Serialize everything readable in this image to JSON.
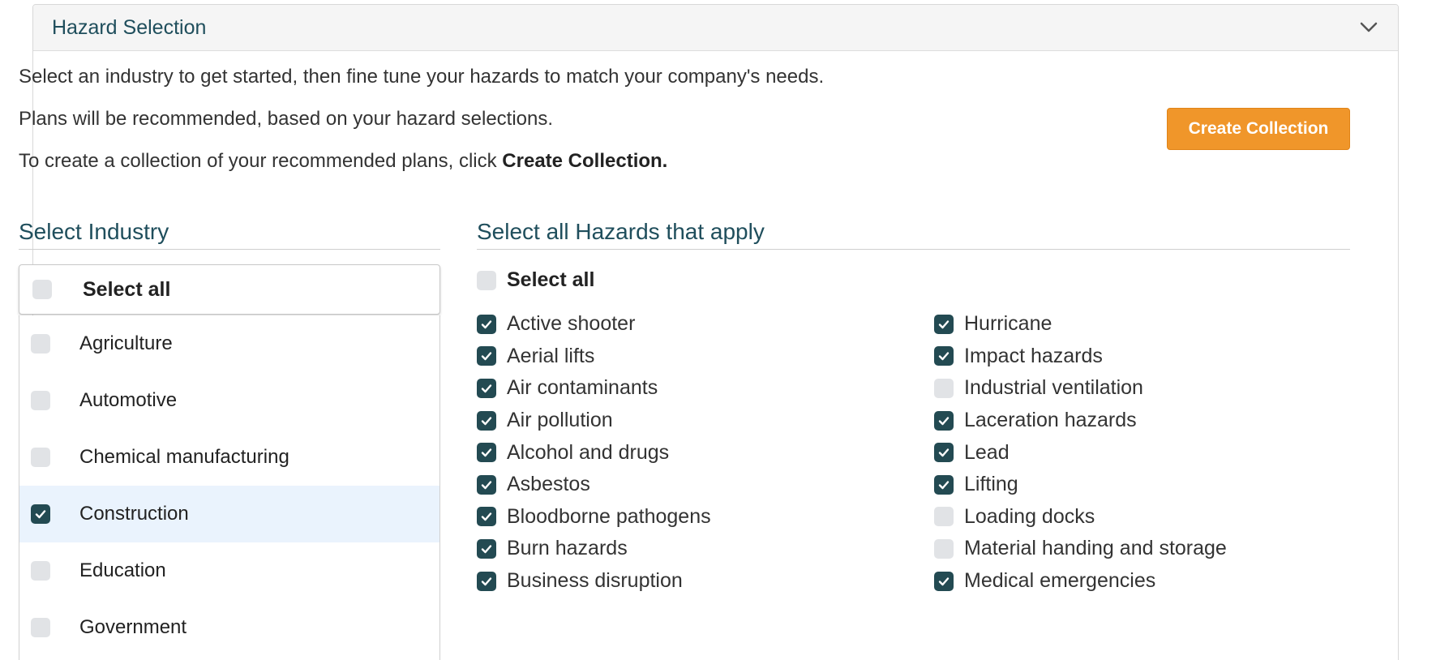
{
  "panel": {
    "title": "Hazard Selection",
    "collapse_icon": "chevron-down-icon"
  },
  "intro": {
    "line1": "Select an industry to get started, then fine tune your hazards to match your company's needs.",
    "line2": "Plans will be recommended, based on your hazard selections.",
    "line3_prefix": "To create a collection of your recommended plans, click ",
    "line3_bold": "Create Collection."
  },
  "create_button": "Create Collection",
  "industry": {
    "title": "Select Industry",
    "select_all": {
      "label": "Select all",
      "checked": false
    },
    "items": [
      {
        "label": "Agriculture",
        "checked": false
      },
      {
        "label": "Automotive",
        "checked": false
      },
      {
        "label": "Chemical manufacturing",
        "checked": false
      },
      {
        "label": "Construction",
        "checked": true
      },
      {
        "label": "Education",
        "checked": false
      },
      {
        "label": "Government",
        "checked": false
      }
    ]
  },
  "hazards": {
    "title": "Select all Hazards that apply",
    "select_all": {
      "label": "Select all",
      "checked": false
    },
    "column1": [
      {
        "label": "Active shooter",
        "checked": true
      },
      {
        "label": "Aerial lifts",
        "checked": true
      },
      {
        "label": "Air contaminants",
        "checked": true
      },
      {
        "label": "Air pollution",
        "checked": true
      },
      {
        "label": "Alcohol and drugs",
        "checked": true
      },
      {
        "label": "Asbestos",
        "checked": true
      },
      {
        "label": "Bloodborne pathogens",
        "checked": true
      },
      {
        "label": "Burn hazards",
        "checked": true
      },
      {
        "label": "Business disruption",
        "checked": true
      }
    ],
    "column2": [
      {
        "label": "Hurricane",
        "checked": true
      },
      {
        "label": "Impact hazards",
        "checked": true
      },
      {
        "label": "Industrial ventilation",
        "checked": false
      },
      {
        "label": "Laceration hazards",
        "checked": true
      },
      {
        "label": "Lead",
        "checked": true
      },
      {
        "label": "Lifting",
        "checked": true
      },
      {
        "label": "Loading docks",
        "checked": false
      },
      {
        "label": "Material handing and storage",
        "checked": false
      },
      {
        "label": "Medical emergencies",
        "checked": true
      }
    ]
  },
  "colors": {
    "accent_title": "#1f4e5c",
    "checkbox_checked": "#234a52",
    "checkbox_unchecked": "#e1e3e6",
    "button_orange": "#f0962a",
    "selected_row": "#eaf3fd"
  }
}
